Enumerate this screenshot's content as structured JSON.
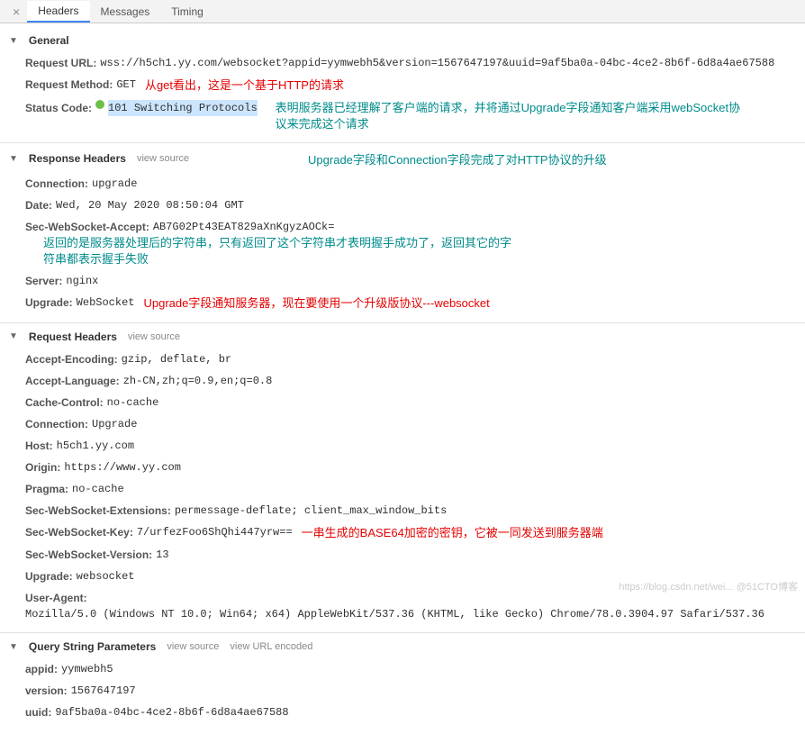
{
  "tabs": {
    "close": "×",
    "headers": "Headers",
    "messages": "Messages",
    "timing": "Timing"
  },
  "general": {
    "title": "General",
    "request_url_k": "Request URL:",
    "request_url_v": "wss://h5ch1.yy.com/websocket?appid=yymwebh5&version=1567647197&uuid=9af5ba0a-04bc-4ce2-8b6f-6d8a4ae67588",
    "request_method_k": "Request Method:",
    "request_method_v": "GET",
    "request_method_annot": "从get看出，这是一个基于HTTP的请求",
    "status_code_k": "Status Code:",
    "status_code_v": "101 Switching Protocols",
    "status_code_annot": "表明服务器已经理解了客户端的请求，并将通过Upgrade字段通知客户端采用webSocket协议来完成这个请求"
  },
  "response": {
    "title": "Response Headers",
    "view_source": "view source",
    "annot": "Upgrade字段和Connection字段完成了对HTTP协议的升级",
    "connection_k": "Connection:",
    "connection_v": "upgrade",
    "date_k": "Date:",
    "date_v": "Wed, 20 May 2020 08:50:04 GMT",
    "swsa_k": "Sec-WebSocket-Accept:",
    "swsa_v": "AB7G02Pt43EAT829aXnKgyzAOCk=",
    "swsa_annot": "返回的是服务器处理后的字符串，只有返回了这个字符串才表明握手成功了，返回其它的字符串都表示握手失败",
    "server_k": "Server:",
    "server_v": "nginx",
    "upgrade_k": "Upgrade:",
    "upgrade_v": "WebSocket",
    "upgrade_annot": "Upgrade字段通知服务器，现在要使用一个升级版协议---websocket"
  },
  "request": {
    "title": "Request Headers",
    "view_source": "view source",
    "ae_k": "Accept-Encoding:",
    "ae_v": "gzip, deflate, br",
    "al_k": "Accept-Language:",
    "al_v": "zh-CN,zh;q=0.9,en;q=0.8",
    "cc_k": "Cache-Control:",
    "cc_v": "no-cache",
    "conn_k": "Connection:",
    "conn_v": "Upgrade",
    "host_k": "Host:",
    "host_v": "h5ch1.yy.com",
    "origin_k": "Origin:",
    "origin_v": "https://www.yy.com",
    "pragma_k": "Pragma:",
    "pragma_v": "no-cache",
    "swse_k": "Sec-WebSocket-Extensions:",
    "swse_v": "permessage-deflate; client_max_window_bits",
    "swsk_k": "Sec-WebSocket-Key:",
    "swsk_v": "7/urfezFoo6ShQhi447yrw==",
    "swsk_annot": "一串生成的BASE64加密的密钥，它被一同发送到服务器端",
    "swsv_k": "Sec-WebSocket-Version:",
    "swsv_v": "13",
    "upg_k": "Upgrade:",
    "upg_v": "websocket",
    "ua_k": "User-Agent:",
    "ua_v": "Mozilla/5.0 (Windows NT 10.0; Win64; x64) AppleWebKit/537.36 (KHTML, like Gecko) Chrome/78.0.3904.97 Safari/537.36"
  },
  "query": {
    "title": "Query String Parameters",
    "view_source": "view source",
    "view_url_encoded": "view URL encoded",
    "appid_k": "appid:",
    "appid_v": "yymwebh5",
    "version_k": "version:",
    "version_v": "1567647197",
    "uuid_k": "uuid:",
    "uuid_v": "9af5ba0a-04bc-4ce2-8b6f-6d8a4ae67588"
  },
  "watermark": "https://blog.csdn.net/wei... @51CTO博客"
}
